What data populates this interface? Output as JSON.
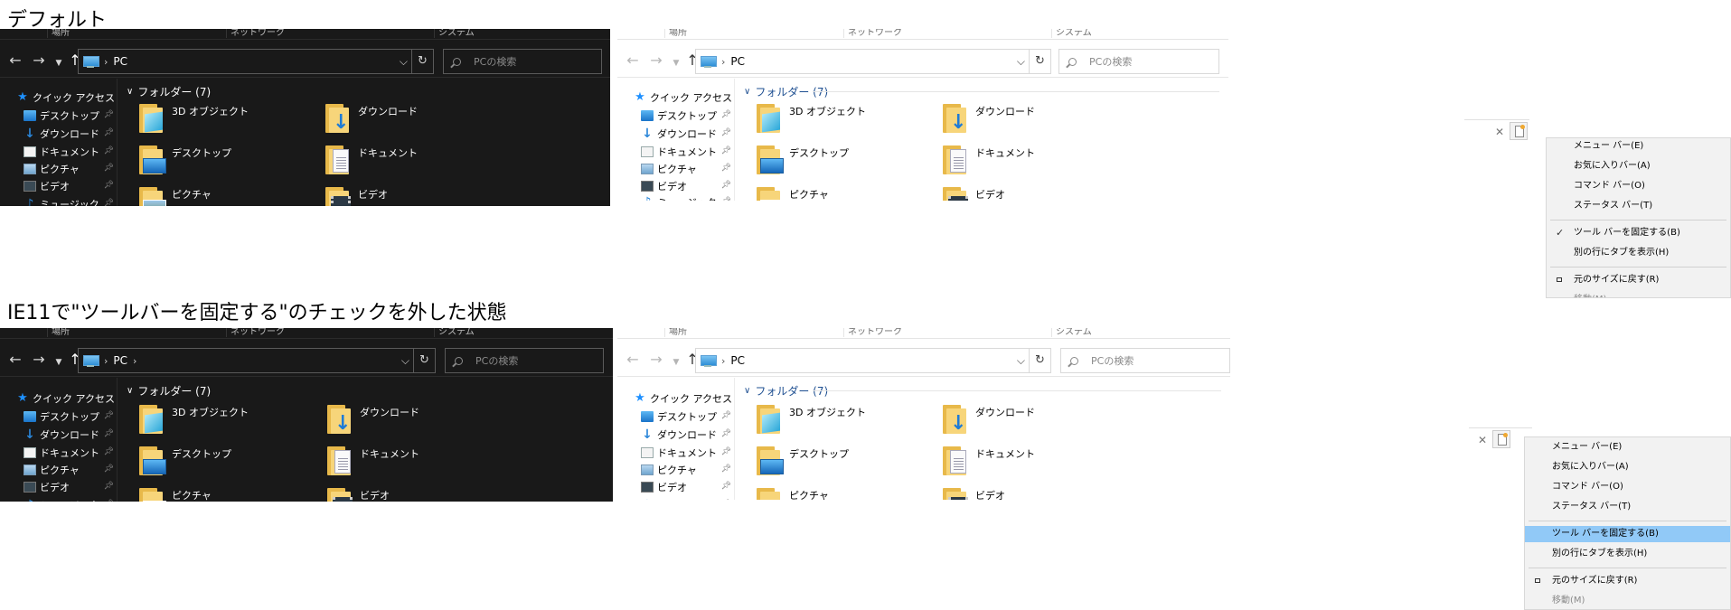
{
  "headings": {
    "default": "デフォルト",
    "unlocked": "IE11で\"ツールバーを固定する\"のチェックを外した状態"
  },
  "explorer": {
    "columns": [
      "場所",
      "ネットワーク",
      "システム"
    ],
    "address_text": "PC",
    "search_placeholder": "PCの検索",
    "nav_header": "クイック アクセス",
    "nav_items": [
      "デスクトップ",
      "ダウンロード",
      "ドキュメント",
      "ピクチャ",
      "ビデオ",
      "ミュージック"
    ],
    "group_title": "フォルダー (7)",
    "folders": [
      "3D オブジェクト",
      "ダウンロード",
      "デスクトップ",
      "ドキュメント",
      "ピクチャ",
      "ビデオ"
    ]
  },
  "ie_menu": {
    "items": [
      "メニュー バー(E)",
      "お気に入りバー(A)",
      "コマンド バー(O)",
      "ステータス バー(T)",
      "ツール バーを固定する(B)",
      "別の行にタブを表示(H)",
      "元のサイズに戻す(R)",
      "移動(M)"
    ],
    "checked_item": "ツール バーを固定する(B)",
    "highlight_color": "#91c9f7"
  },
  "icons": {
    "back": "back-arrow-icon",
    "forward": "forward-arrow-icon",
    "recent": "chevron-down-icon",
    "up": "up-arrow-icon",
    "refresh": "refresh-icon",
    "search": "search-icon",
    "pin": "pin-icon",
    "close": "close-icon"
  },
  "colors": {
    "dark_bg": "#191919",
    "light_bg": "#ffffff",
    "group_title_light": "#1e4f91",
    "accent": "#2a86d9"
  }
}
